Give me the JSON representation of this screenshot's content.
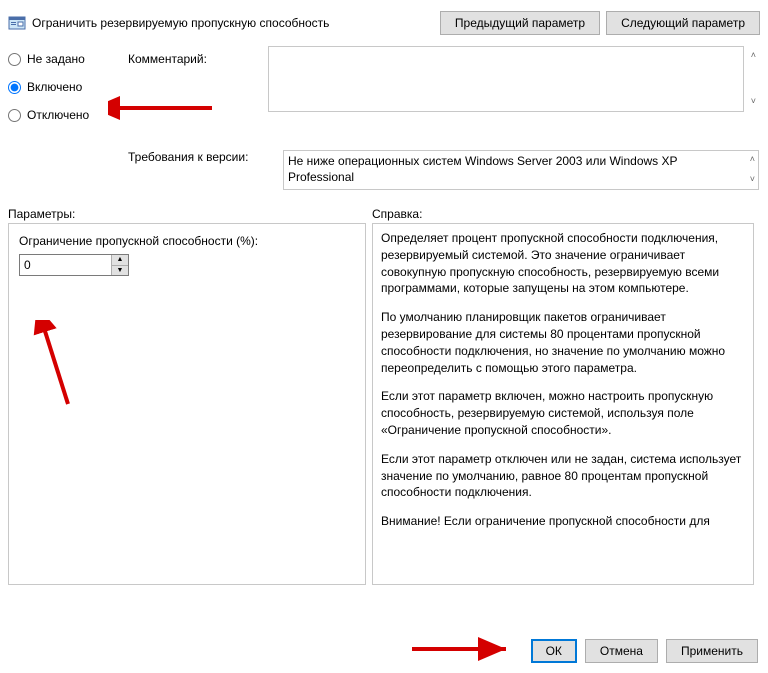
{
  "window": {
    "title": "Ограничить резервируемую пропускную способность"
  },
  "nav": {
    "prev": "Предыдущий параметр",
    "next": "Следующий параметр"
  },
  "state": {
    "not_configured": "Не задано",
    "enabled": "Включено",
    "disabled": "Отключено"
  },
  "comment": {
    "label": "Комментарий:",
    "value": ""
  },
  "requirements": {
    "label": "Требования к версии:",
    "value": "Не ниже операционных систем Windows Server 2003 или Windows XP Professional"
  },
  "params": {
    "heading": "Параметры:",
    "bandwidth_label": "Ограничение пропускной способности (%):",
    "bandwidth_value": "0"
  },
  "help": {
    "heading": "Справка:",
    "p1": "Определяет процент пропускной способности подключения, резервируемый системой. Это значение ограничивает совокупную пропускную способность, резервируемую всеми программами, которые запущены на этом компьютере.",
    "p2": "По умолчанию планировщик пакетов ограничивает резервирование для системы 80 процентами пропускной способности подключения, но значение по умолчанию можно переопределить с помощью этого параметра.",
    "p3": "Если этот параметр включен, можно настроить пропускную способность, резервируемую системой, используя поле «Ограничение пропускной способности».",
    "p4": "Если этот параметр отключен или не задан, система использует значение по умолчанию, равное 80 процентам пропускной способности подключения.",
    "p5": "Внимание! Если ограничение пропускной способности для"
  },
  "footer": {
    "ok": "ОК",
    "cancel": "Отмена",
    "apply": "Применить"
  },
  "colors": {
    "arrow": "#d40000",
    "focus": "#0078d7"
  }
}
